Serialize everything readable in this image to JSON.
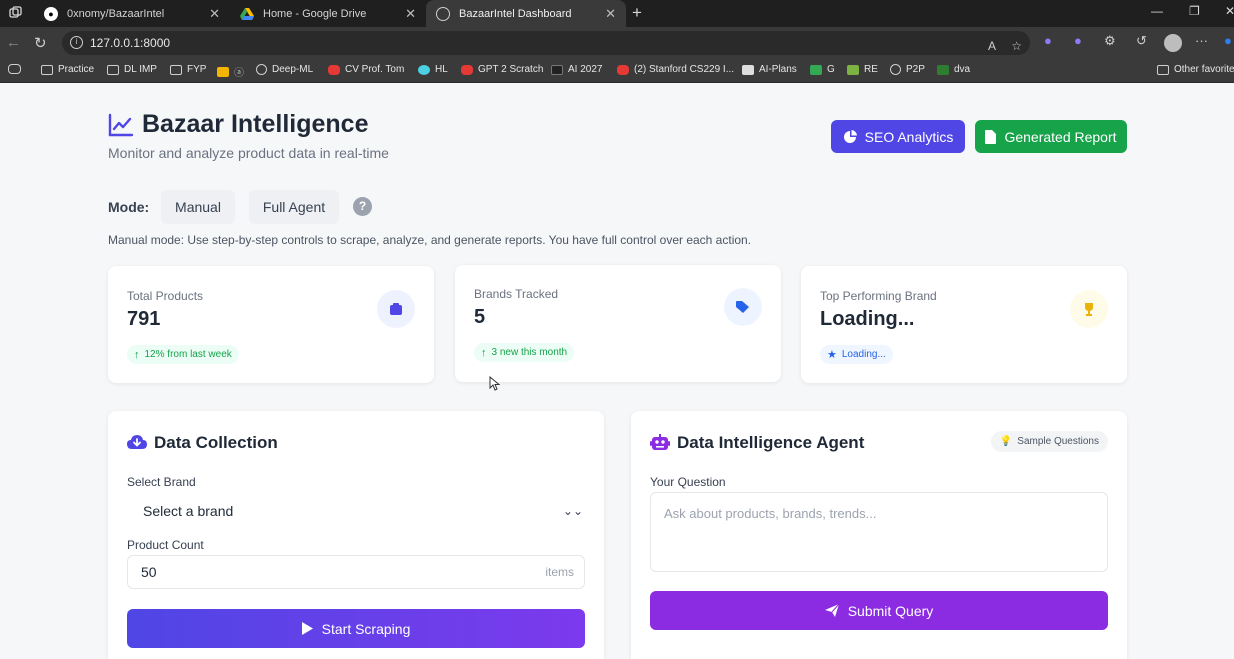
{
  "browser": {
    "tabs": [
      {
        "label": "0xnomy/BazaarIntel",
        "icon": "github-icon"
      },
      {
        "label": "Home - Google Drive",
        "icon": "google-drive-icon"
      },
      {
        "label": "BazaarIntel Dashboard",
        "icon": "globe-icon"
      }
    ],
    "url": "127.0.0.1:8000",
    "bookmarks": [
      "Practice",
      "DL IMP",
      "FYP",
      "Deep-ML",
      "CV Prof. Tom",
      "HL",
      "GPT 2 Scratch",
      "AI 2027",
      "(2) Stanford CS229 I...",
      "AI-Plans",
      "G",
      "RE",
      "P2P",
      "dva",
      "Other favorites"
    ]
  },
  "header": {
    "title": "Bazaar Intelligence",
    "subtitle": "Monitor and analyze product data in real-time",
    "seo_label": "SEO Analytics",
    "report_label": "Generated Report"
  },
  "mode": {
    "label": "Mode:",
    "manual_label": "Manual",
    "agent_label": "Full Agent",
    "help": "?",
    "description": "Manual mode: Use step-by-step controls to scrape, analyze, and generate reports. You have full control over each action."
  },
  "stats": [
    {
      "label": "Total Products",
      "value": "791",
      "badge": "12% from last week"
    },
    {
      "label": "Brands Tracked",
      "value": "5",
      "badge": "3 new this month"
    },
    {
      "label": "Top Performing Brand",
      "value": "Loading...",
      "badge": "Loading..."
    }
  ],
  "collection": {
    "title": "Data Collection",
    "brand_label": "Select Brand",
    "brand_value": "Select a brand",
    "count_label": "Product Count",
    "count_value": "50",
    "count_suffix": "items",
    "scrape_label": "Start Scraping"
  },
  "agent": {
    "title": "Data Intelligence Agent",
    "sample_label": "Sample Questions",
    "question_label": "Your Question",
    "question_placeholder": "Ask about products, brands, trends...",
    "submit_label": "Submit Query"
  },
  "colors": {
    "indigo": "#4f46e5",
    "green": "#16a34a",
    "purple": "#8b2be2"
  }
}
